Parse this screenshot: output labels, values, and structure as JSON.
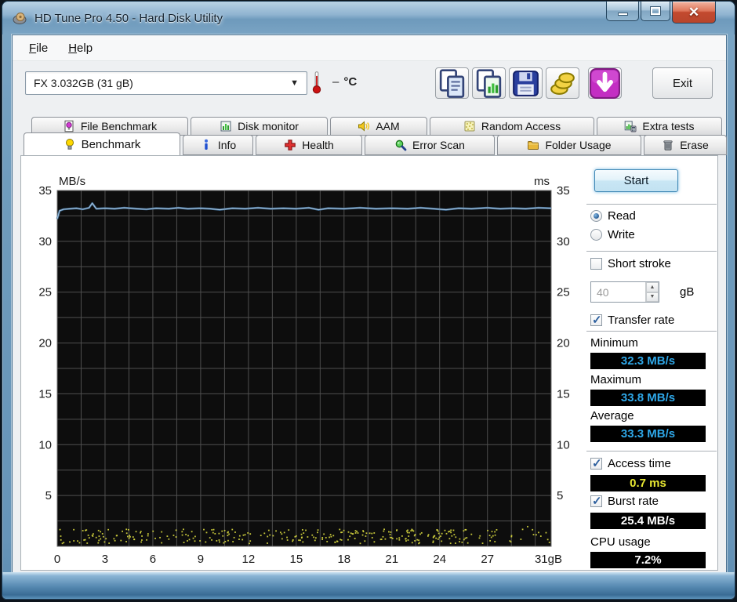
{
  "window": {
    "title": "HD Tune Pro 4.50 - Hard Disk Utility",
    "controls": {
      "minimize": "minimize",
      "maximize": "maximize",
      "close": "close"
    }
  },
  "menu": {
    "items": [
      "File",
      "Help"
    ]
  },
  "toolbar": {
    "drive_selected": "FX 3.032GB (31 gB)",
    "temperature_value": "–",
    "temperature_unit": "°C",
    "exit_label": "Exit",
    "buttons": [
      {
        "name": "copy-info-button",
        "icon": "copy"
      },
      {
        "name": "copy-screenshot-button",
        "icon": "copy-image"
      },
      {
        "name": "save-screenshot-button",
        "icon": "floppy"
      },
      {
        "name": "options-button",
        "icon": "coins"
      },
      {
        "name": "csv-export-button",
        "icon": "download"
      }
    ]
  },
  "tabs": {
    "row1": [
      {
        "label": "File Benchmark",
        "icon": "file-benchmark"
      },
      {
        "label": "Disk monitor",
        "icon": "disk-monitor"
      },
      {
        "label": "AAM",
        "icon": "aam"
      },
      {
        "label": "Random Access",
        "icon": "random-access"
      },
      {
        "label": "Extra tests",
        "icon": "extra-tests"
      }
    ],
    "row2": [
      {
        "label": "Benchmark",
        "icon": "benchmark",
        "active": true
      },
      {
        "label": "Info",
        "icon": "info"
      },
      {
        "label": "Health",
        "icon": "health"
      },
      {
        "label": "Error Scan",
        "icon": "error-scan"
      },
      {
        "label": "Folder Usage",
        "icon": "folder-usage"
      },
      {
        "label": "Erase",
        "icon": "erase"
      }
    ]
  },
  "panel": {
    "start_label": "Start",
    "read_label": "Read",
    "write_label": "Write",
    "read_selected": true,
    "short_stroke_label": "Short stroke",
    "short_stroke_checked": false,
    "short_stroke_value": "40",
    "short_stroke_unit": "gB",
    "transfer_rate_label": "Transfer rate",
    "transfer_rate_checked": true,
    "minimum_label": "Minimum",
    "maximum_label": "Maximum",
    "average_label": "Average",
    "access_time_label": "Access time",
    "access_time_checked": true,
    "burst_rate_label": "Burst rate",
    "burst_rate_checked": true,
    "cpu_usage_label": "CPU usage"
  },
  "chart_data": {
    "type": "line",
    "left_axis_label": "MB/s",
    "right_axis_label": "ms",
    "xlim": [
      0,
      31
    ],
    "ylim": [
      0,
      35
    ],
    "y_ticks": [
      35,
      30,
      25,
      20,
      15,
      10,
      5
    ],
    "x_ticks": [
      {
        "v": 0,
        "label": "0"
      },
      {
        "v": 3,
        "label": "3"
      },
      {
        "v": 6,
        "label": "6"
      },
      {
        "v": 9,
        "label": "9"
      },
      {
        "v": 12,
        "label": "12"
      },
      {
        "v": 15,
        "label": "15"
      },
      {
        "v": 18,
        "label": "18"
      },
      {
        "v": 21,
        "label": "21"
      },
      {
        "v": 24,
        "label": "24"
      },
      {
        "v": 27,
        "label": "27"
      },
      {
        "v": 31,
        "label": "31gB"
      }
    ],
    "grid": {
      "x_step": 1.5,
      "y_step": 2.5,
      "color": "#4f4f4f",
      "bg": "#0d0d0d",
      "border": "#6e6e6e"
    },
    "series": [
      {
        "name": "transfer-rate",
        "type": "line",
        "unit": "MB/s",
        "color": "#a5c4e0",
        "core_color": "#3f698f",
        "points": [
          [
            0,
            32.2
          ],
          [
            0.15,
            33.0
          ],
          [
            0.4,
            33.15
          ],
          [
            0.8,
            33.2
          ],
          [
            1.2,
            33.25
          ],
          [
            1.6,
            33.15
          ],
          [
            2.0,
            33.3
          ],
          [
            2.2,
            33.75
          ],
          [
            2.45,
            33.2
          ],
          [
            3,
            33.25
          ],
          [
            3.6,
            33.2
          ],
          [
            4.2,
            33.3
          ],
          [
            5,
            33.2
          ],
          [
            5.6,
            33.15
          ],
          [
            6.2,
            33.25
          ],
          [
            7,
            33.2
          ],
          [
            7.6,
            33.3
          ],
          [
            8.2,
            33.2
          ],
          [
            9,
            33.25
          ],
          [
            9.6,
            33.2
          ],
          [
            10.2,
            33.1
          ],
          [
            11,
            33.25
          ],
          [
            11.8,
            33.2
          ],
          [
            12.6,
            33.3
          ],
          [
            13.4,
            33.2
          ],
          [
            14.2,
            33.25
          ],
          [
            15,
            33.2
          ],
          [
            15.8,
            33.3
          ],
          [
            16.4,
            33.1
          ],
          [
            17,
            33.25
          ],
          [
            18,
            33.2
          ],
          [
            19,
            33.3
          ],
          [
            20,
            33.2
          ],
          [
            21,
            33.25
          ],
          [
            22,
            33.2
          ],
          [
            22.8,
            33.3
          ],
          [
            23.6,
            33.2
          ],
          [
            24.4,
            33.1
          ],
          [
            25.2,
            33.25
          ],
          [
            26,
            33.2
          ],
          [
            27,
            33.3
          ],
          [
            27.8,
            33.2
          ],
          [
            28.6,
            33.25
          ],
          [
            29.4,
            33.2
          ],
          [
            30.2,
            33.3
          ],
          [
            31,
            33.25
          ]
        ]
      },
      {
        "name": "access-time",
        "type": "scatter",
        "unit": "ms",
        "color": "#d9d93f",
        "band": [
          0.35,
          1.75
        ],
        "count": 330,
        "seed": 7,
        "x_max": 30.9,
        "fade_after": 27.5
      }
    ],
    "stats": {
      "minimum": "32.3 MB/s",
      "maximum": "33.8 MB/s",
      "average": "33.3 MB/s",
      "access_time": "0.7 ms",
      "burst_rate": "25.4 MB/s",
      "cpu_usage": "7.2%"
    }
  }
}
